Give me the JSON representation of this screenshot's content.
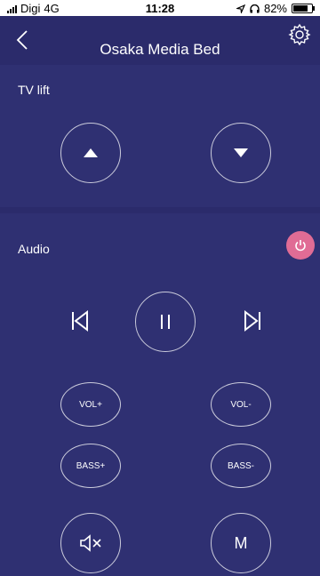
{
  "status_bar": {
    "carrier": "Digi",
    "network": "4G",
    "time": "11:28",
    "battery_percent": "82%",
    "battery_level": 0.82
  },
  "nav": {
    "title": "Osaka Media Bed",
    "back_icon": "chevron-left-icon",
    "settings_icon": "gear-icon"
  },
  "tv_lift": {
    "label": "TV lift",
    "up_icon": "triangle-up-icon",
    "down_icon": "triangle-down-icon"
  },
  "audio": {
    "label": "Audio",
    "power_color": "#e06c95",
    "prev_icon": "skip-back-icon",
    "play_pause_icon": "pause-icon",
    "next_icon": "skip-forward-icon",
    "vol_up_label": "VOL+",
    "vol_down_label": "VOL-",
    "bass_up_label": "BASS+",
    "bass_down_label": "BASS-",
    "mute_icon": "speaker-mute-icon",
    "mode_label": "M"
  },
  "colors": {
    "background": "#2b2b6b",
    "panel": "#2f3072",
    "accent": "#e06c95"
  }
}
